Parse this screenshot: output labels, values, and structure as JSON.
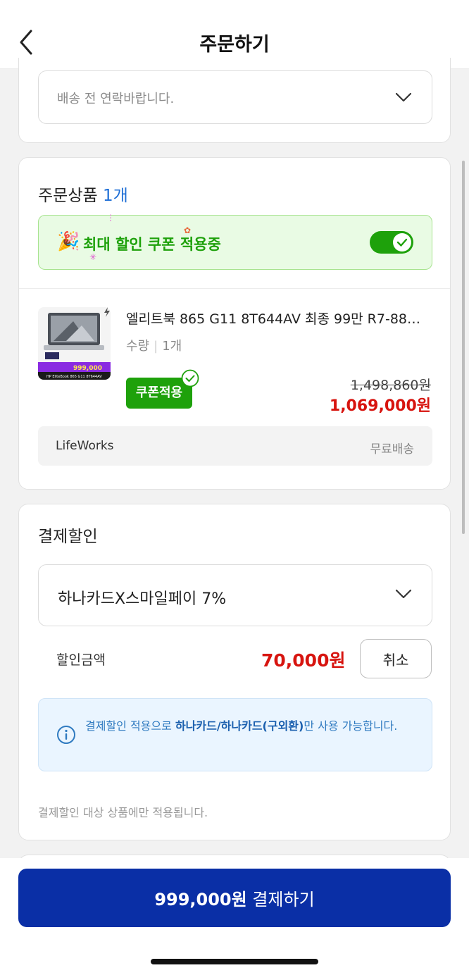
{
  "header": {
    "title": "주문하기",
    "back_icon": "chevron-left-icon"
  },
  "delivery": {
    "request_value": "배송 전 연락바랍니다."
  },
  "order_items": {
    "title": "주문상품",
    "count": "1개",
    "coupon_banner": {
      "text": "최대 할인 쿠폰 적용중",
      "toggle_on": true
    },
    "product": {
      "name": "엘리트북 865 G11 8T644AV 최종 99만 R7-88…",
      "qty_label": "수량",
      "qty_value": "1개",
      "coupon_badge": "쿠폰적용",
      "original_price": "1,498,860원",
      "sale_price": "1,069,000원",
      "thumb_tag": "999,000",
      "thumb_caption": "HP EliteBook 865 G11 8T644AV"
    },
    "seller": {
      "name": "LifeWorks",
      "shipping": "무료배송"
    }
  },
  "payment_discount": {
    "title": "결제할인",
    "selected_method": "하나카드X스마일페이 7%",
    "discount_label": "할인금액",
    "discount_amount": "70,000원",
    "cancel_label": "취소",
    "info": {
      "prefix": "결제할인 적용으로 ",
      "highlight": "하나카드/하나카드(구외환)",
      "suffix": "만 사용 가능합니다."
    },
    "footnote": "결제할인 대상 상품에만 적용됩니다."
  },
  "checkout": {
    "amount": "999,000원",
    "label": " 결제하기"
  },
  "colors": {
    "accent_blue": "#0a2fa6",
    "sale_red": "#d7140f",
    "coupon_green": "#1ea10b"
  }
}
